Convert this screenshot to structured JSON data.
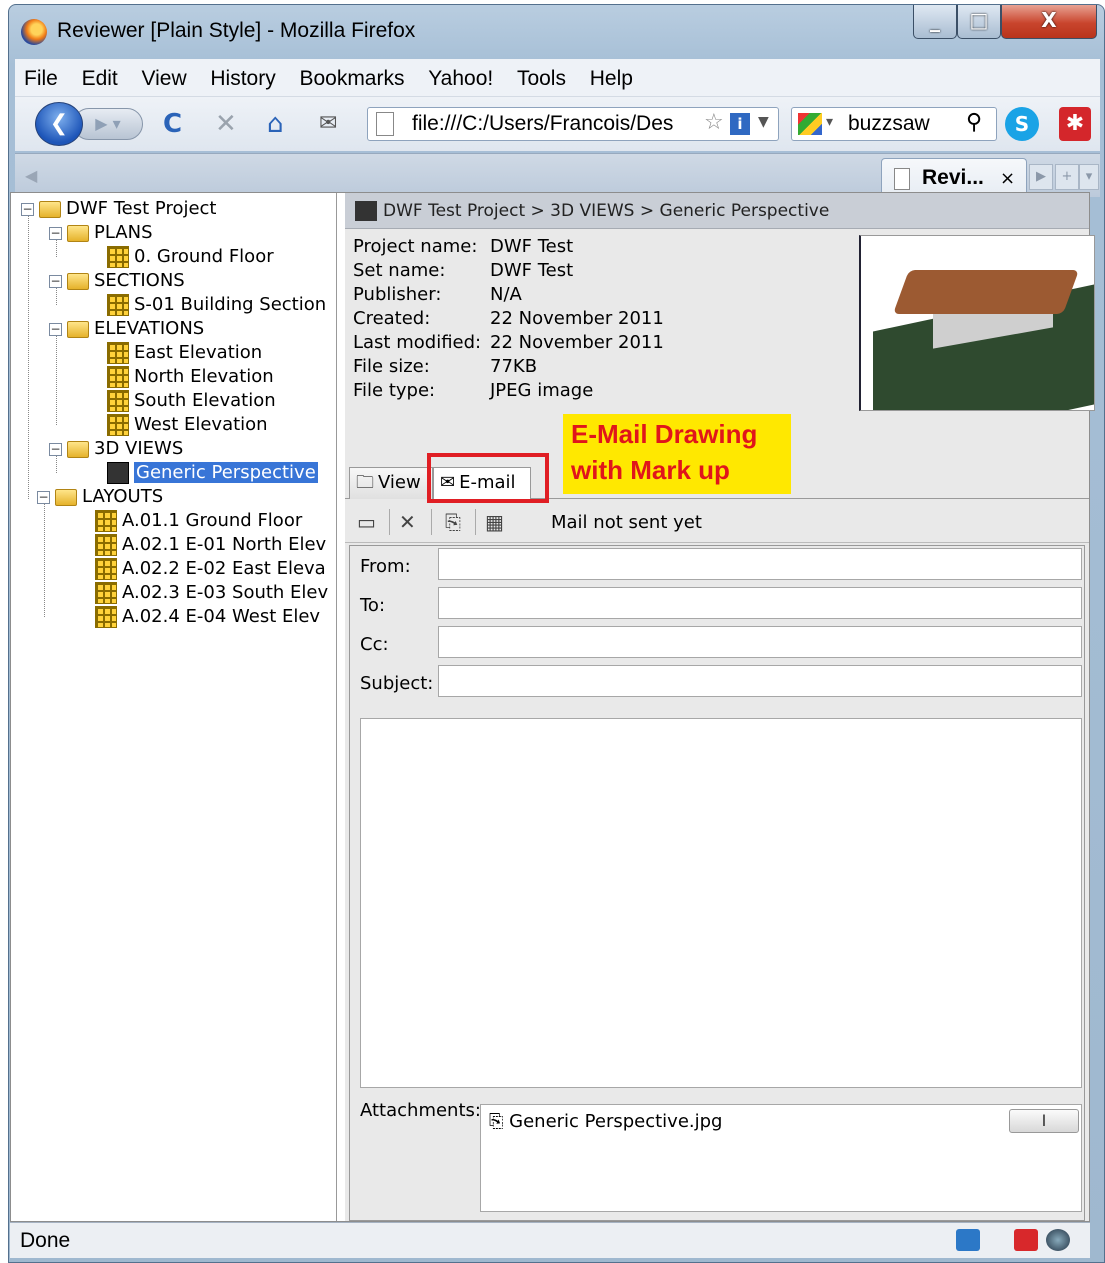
{
  "window": {
    "title": "Reviewer [Plain Style] - Mozilla Firefox",
    "close_glyph": "X",
    "min_glyph": "_",
    "max_glyph": "□"
  },
  "menu": [
    "File",
    "Edit",
    "View",
    "History",
    "Bookmarks",
    "Yahoo!",
    "Tools",
    "Help"
  ],
  "nav": {
    "url": "file:///C:/Users/Francois/Des",
    "search": "buzzsaw"
  },
  "tab": {
    "label": "Revi...",
    "close": "×"
  },
  "tree": {
    "root": "DWF Test Project",
    "plans": "PLANS",
    "plans_item": "0. Ground Floor",
    "sections": "SECTIONS",
    "sections_item": "S-01 Building Section",
    "elevations": "ELEVATIONS",
    "elev_items": [
      "East Elevation",
      "North Elevation",
      "South Elevation",
      "West Elevation"
    ],
    "views3d": "3D VIEWS",
    "views3d_item": "Generic Perspective",
    "layouts": "LAYOUTS",
    "layout_items": [
      "A.01.1 Ground Floor",
      "A.02.1 E-01 North Elev",
      "A.02.2 E-02 East Eleva",
      "A.02.3 E-03 South Elev",
      "A.02.4 E-04 West Elev"
    ]
  },
  "breadcrumb": "DWF Test Project > 3D VIEWS > Generic Perspective",
  "props": [
    {
      "k": "Project name:",
      "v": "DWF Test"
    },
    {
      "k": "Set name:",
      "v": "DWF Test"
    },
    {
      "k": "Publisher:",
      "v": "N/A"
    },
    {
      "k": "Created:",
      "v": "22 November 2011"
    },
    {
      "k": "Last modified:",
      "v": "22 November 2011"
    },
    {
      "k": "File size:",
      "v": "77KB"
    },
    {
      "k": "File type:",
      "v": "JPEG image"
    }
  ],
  "callout": {
    "line1": "E-Mail Drawing",
    "line2": "with Mark up"
  },
  "panel_tabs": {
    "view": "View",
    "email": "E-mail"
  },
  "email": {
    "status": "Mail not sent yet",
    "from_label": "From:",
    "to_label": "To:",
    "cc_label": "Cc:",
    "subject_label": "Subject:",
    "from_value": "",
    "to_value": "",
    "cc_value": "",
    "subject_value": "",
    "attachments_label": "Attachments:",
    "attachment": "Generic Perspective.jpg"
  },
  "status": {
    "text": "Done"
  },
  "colors": {
    "selection": "#3875d7",
    "callout_bg": "#ffe800",
    "callout_text": "#e0151b",
    "highlight_box": "#e01e24"
  }
}
